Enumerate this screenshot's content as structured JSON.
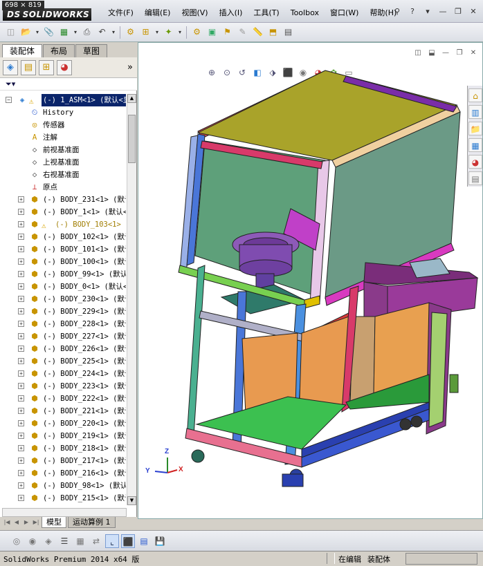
{
  "dimension_tag": "698 × 819",
  "app": {
    "logo": "SOLIDWORKS",
    "logo_prefix": "DS"
  },
  "menu": [
    "文件(F)",
    "编辑(E)",
    "视图(V)",
    "插入(I)",
    "工具(T)",
    "Toolbox",
    "窗口(W)",
    "帮助(H)"
  ],
  "window_controls": {
    "min": "—",
    "restore": "❐",
    "close": "✕"
  },
  "manager_tabs": {
    "assembly": "装配体",
    "layout": "布局",
    "sketch": "草图"
  },
  "filter_icon": "funnel-icon",
  "tree": {
    "root": "(-) 1_ASM<1> (默认<显",
    "features": [
      {
        "label": "History",
        "icon": "history-icon"
      },
      {
        "label": "传感器",
        "icon": "sensor-icon"
      },
      {
        "label": "注解",
        "icon": "annotation-icon"
      },
      {
        "label": "前视基准面",
        "icon": "plane-icon"
      },
      {
        "label": "上视基准面",
        "icon": "plane-icon"
      },
      {
        "label": "右视基准面",
        "icon": "plane-icon"
      },
      {
        "label": "原点",
        "icon": "origin-icon"
      }
    ],
    "parts": [
      {
        "label": "(-) BODY_231<1> (默认",
        "warn": false
      },
      {
        "label": "(-) BODY_1<1> (默认<",
        "warn": false
      },
      {
        "label": "(-) BODY_103<1> (",
        "warn": true
      },
      {
        "label": "(-) BODY_102<1> (默认",
        "warn": false
      },
      {
        "label": "(-) BODY_101<1> (默认",
        "warn": false
      },
      {
        "label": "(-) BODY_100<1> (默认",
        "warn": false
      },
      {
        "label": "(-) BODY_99<1> (默认",
        "warn": false
      },
      {
        "label": "(-) BODY_0<1> (默认<",
        "warn": false
      },
      {
        "label": "(-) BODY_230<1> (默认",
        "warn": false
      },
      {
        "label": "(-) BODY_229<1> (默认",
        "warn": false
      },
      {
        "label": "(-) BODY_228<1> (默认",
        "warn": false
      },
      {
        "label": "(-) BODY_227<1> (默认",
        "warn": false
      },
      {
        "label": "(-) BODY_226<1> (默认",
        "warn": false
      },
      {
        "label": "(-) BODY_225<1> (默认",
        "warn": false
      },
      {
        "label": "(-) BODY_224<1> (默认",
        "warn": false
      },
      {
        "label": "(-) BODY_223<1> (默认",
        "warn": false
      },
      {
        "label": "(-) BODY_222<1> (默认",
        "warn": false
      },
      {
        "label": "(-) BODY_221<1> (默认",
        "warn": false
      },
      {
        "label": "(-) BODY_220<1> (默认",
        "warn": false
      },
      {
        "label": "(-) BODY_219<1> (默认",
        "warn": false
      },
      {
        "label": "(-) BODY_218<1> (默认",
        "warn": false
      },
      {
        "label": "(-) BODY_217<1> (默认",
        "warn": false
      },
      {
        "label": "(-) BODY_216<1> (默认",
        "warn": false
      },
      {
        "label": "(-) BODY_98<1> (默认",
        "warn": false
      },
      {
        "label": "(-) BODY_215<1> (默认",
        "warn": false
      }
    ]
  },
  "bottom_tabs": {
    "model": "模型",
    "motion": "运动算例 1"
  },
  "triad": {
    "x": "X",
    "y": "Y",
    "z": "Z"
  },
  "status": {
    "left": "SolidWorks Premium 2014 x64 版",
    "editing": "在编辑",
    "mode": "装配体"
  },
  "colors": {
    "selection": "#0a246a",
    "warning": "#d8a400",
    "viewport_bg": "#ffffff"
  }
}
